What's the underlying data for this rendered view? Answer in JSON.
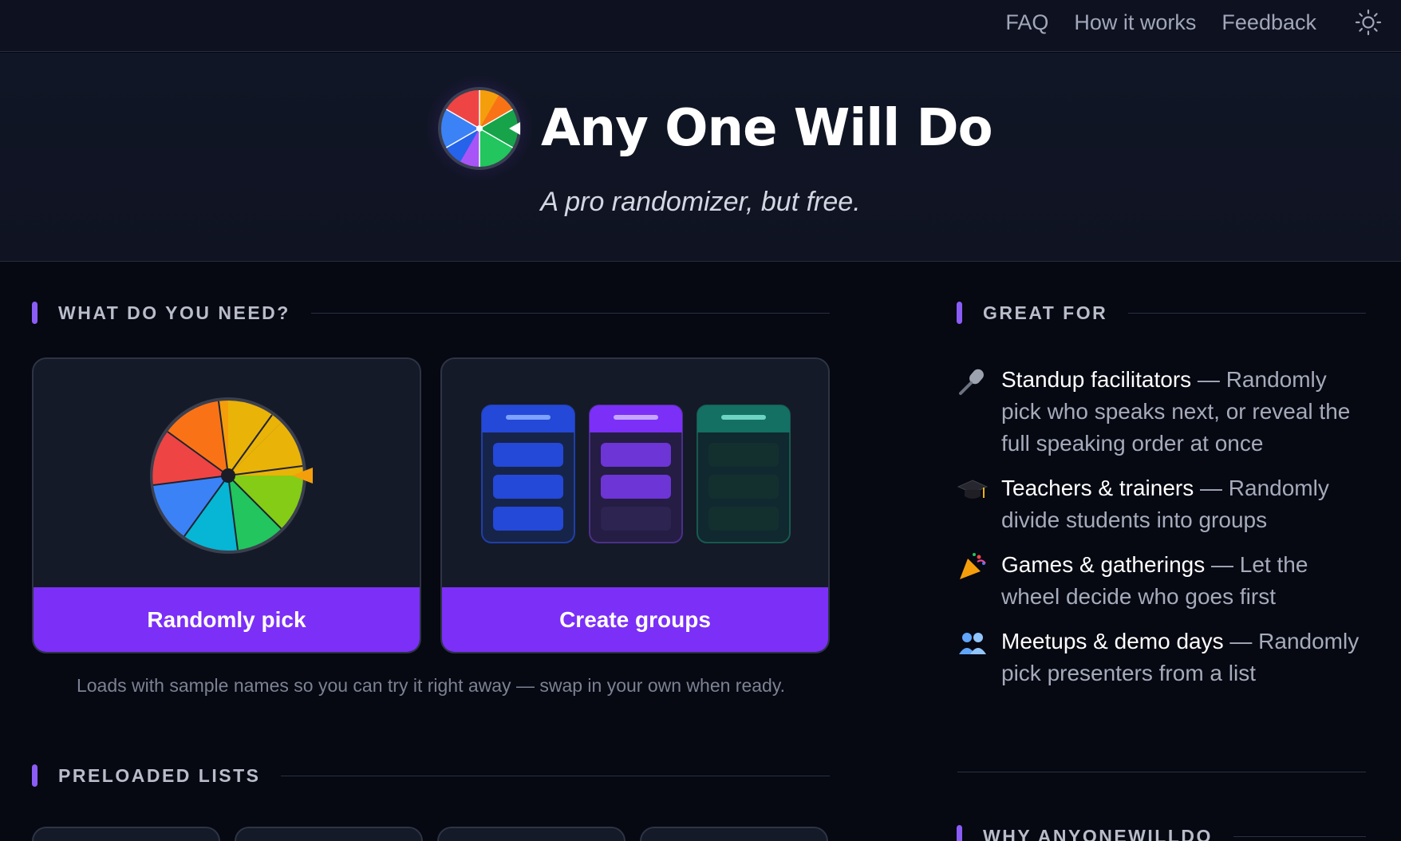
{
  "nav": {
    "links": [
      "FAQ",
      "How it works",
      "Feedback"
    ],
    "theme_icon": "sun-icon"
  },
  "hero": {
    "title": "Any One Will Do",
    "subtitle": "A pro randomizer, but free."
  },
  "sections": {
    "need": "WHAT DO YOU NEED?",
    "great_for": "GREAT FOR",
    "preloaded": "PRELOADED LISTS",
    "why": "WHY ANYONEWILLDO"
  },
  "cards": [
    {
      "label": "Randomly pick",
      "art": "spinner-wheel"
    },
    {
      "label": "Create groups",
      "art": "group-columns"
    }
  ],
  "hint": "Loads with sample names so you can try it right away — swap in your own when ready.",
  "uses": [
    {
      "icon": "microphone-icon",
      "glyph": "🎤",
      "title": "Standup facilitators",
      "desc": " — Randomly pick who speaks next, or reveal the full speaking order at once"
    },
    {
      "icon": "graduation-cap-icon",
      "glyph": "🎓",
      "title": "Teachers & trainers",
      "desc": " — Randomly divide students into groups"
    },
    {
      "icon": "party-popper-icon",
      "glyph": "🎉",
      "title": "Games & gatherings",
      "desc": " — Let the wheel decide who goes first"
    },
    {
      "icon": "people-icon",
      "glyph": "👥",
      "title": "Meetups & demo days",
      "desc": " — Randomly pick presenters from a list"
    }
  ],
  "colors": {
    "accent": "#7b2ff7",
    "section_bar": "#8b5cf6",
    "background": "#060812"
  }
}
